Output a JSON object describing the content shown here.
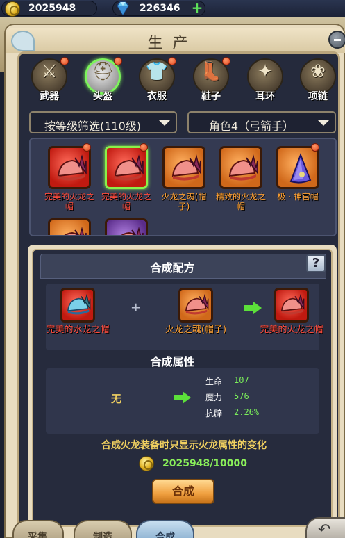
{
  "currency": {
    "gold": "2025948",
    "gems": "226346",
    "add_label": "+"
  },
  "title": "生产",
  "categories": [
    {
      "label": "武器",
      "glyph": "⚔",
      "active": false,
      "badge": true
    },
    {
      "label": "头盔",
      "glyph": "⛑",
      "active": true,
      "badge": true
    },
    {
      "label": "衣服",
      "glyph": "👕",
      "active": false,
      "badge": true
    },
    {
      "label": "鞋子",
      "glyph": "👢",
      "active": false,
      "badge": true
    },
    {
      "label": "耳环",
      "glyph": "✦",
      "active": false,
      "badge": false
    },
    {
      "label": "项链",
      "glyph": "❀",
      "active": false,
      "badge": false
    }
  ],
  "filters": {
    "level": "按等级筛选(110级)",
    "character": "角色4（弓箭手）"
  },
  "items": [
    {
      "name": "完美的火龙之帽",
      "rarity": "red",
      "selected": false,
      "badge": true,
      "icon": "fire-dragon-hat-icon"
    },
    {
      "name": "完美的火龙之帽",
      "rarity": "red",
      "selected": true,
      "badge": true,
      "icon": "fire-dragon-hat-icon"
    },
    {
      "name": "火龙之魂(帽子)",
      "rarity": "orange",
      "selected": false,
      "badge": false,
      "icon": "fire-dragon-hat-icon"
    },
    {
      "name": "精致的火龙之帽",
      "rarity": "orange",
      "selected": false,
      "badge": false,
      "icon": "fire-dragon-hat-icon"
    },
    {
      "name": "极 · 神官帽",
      "rarity": "orange",
      "selected": false,
      "badge": true,
      "icon": "priest-hat-icon"
    },
    {
      "name": "",
      "rarity": "orange",
      "selected": false,
      "badge": false,
      "icon": "hat-icon"
    },
    {
      "name": "",
      "rarity": "purple",
      "selected": false,
      "badge": false,
      "icon": "hat-icon"
    }
  ],
  "recipe": {
    "title": "合成配方",
    "help_label": "?",
    "ingredient1": {
      "name": "完美的水龙之帽",
      "rarity": "red",
      "icon": "water-dragon-hat-icon"
    },
    "ingredient2": {
      "name": "火龙之魂(帽子)",
      "rarity": "orange",
      "icon": "fire-dragon-hat-icon"
    },
    "result": {
      "name": "完美的火龙之帽",
      "rarity": "red",
      "icon": "fire-dragon-hat-icon"
    },
    "plus": "+"
  },
  "attributes": {
    "title": "合成属性",
    "before": "无",
    "stats": [
      {
        "label": "生命",
        "value": "107"
      },
      {
        "label": "魔力",
        "value": "576"
      },
      {
        "label": "抗辟",
        "value": "2.26%"
      }
    ]
  },
  "note": "合成火龙装备时只显示火龙属性的变化",
  "cost": "2025948/10000",
  "craft_label": "合成",
  "bottom_tabs": [
    {
      "label": "采集",
      "active": false,
      "badge": true
    },
    {
      "label": "制造",
      "active": false,
      "badge": false
    },
    {
      "label": "合成",
      "active": true,
      "badge": false
    }
  ],
  "colors": {
    "gold_text": "#f0d060",
    "stat_value": "#7bf05a",
    "red_item": "#ff4a3a",
    "orange_item": "#ffa030",
    "select_green": "#8af04a"
  }
}
